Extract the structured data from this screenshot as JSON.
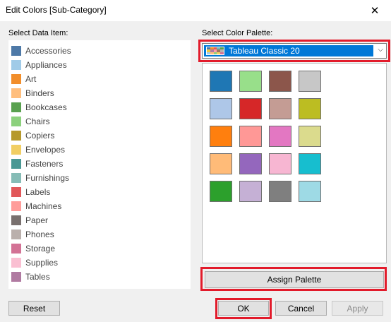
{
  "window": {
    "title": "Edit Colors [Sub-Category]",
    "close_glyph": "✕"
  },
  "left_panel": {
    "label": "Select Data Item:",
    "items": [
      {
        "label": "Accessories",
        "color": "#4e79a7"
      },
      {
        "label": "Appliances",
        "color": "#a0cbe8"
      },
      {
        "label": "Art",
        "color": "#f28e2b"
      },
      {
        "label": "Binders",
        "color": "#ffbe7d"
      },
      {
        "label": "Bookcases",
        "color": "#59a14f"
      },
      {
        "label": "Chairs",
        "color": "#8cd17d"
      },
      {
        "label": "Copiers",
        "color": "#b6992d"
      },
      {
        "label": "Envelopes",
        "color": "#f1ce63"
      },
      {
        "label": "Fasteners",
        "color": "#499894"
      },
      {
        "label": "Furnishings",
        "color": "#86bcb6"
      },
      {
        "label": "Labels",
        "color": "#e15759"
      },
      {
        "label": "Machines",
        "color": "#ff9d9a"
      },
      {
        "label": "Paper",
        "color": "#79706e"
      },
      {
        "label": "Phones",
        "color": "#bab0ac"
      },
      {
        "label": "Storage",
        "color": "#d37295"
      },
      {
        "label": "Supplies",
        "color": "#fabfd2"
      },
      {
        "label": "Tables",
        "color": "#b07aa1"
      }
    ]
  },
  "right_panel": {
    "label": "Select Color Palette:",
    "selected_palette": "Tableau Classic 20",
    "palette_icon_colors": [
      "#4e79a7",
      "#f28e2b",
      "#e15759",
      "#76b7b2",
      "#59a14f",
      "#edc948",
      "#b07aa1",
      "#ff9da7",
      "#9c755f",
      "#bab0ac",
      "#a0cbe8",
      "#ffbe7d",
      "#8cd17d",
      "#f1ce63",
      "#d37295"
    ],
    "palette_colors": [
      [
        "#1f77b4",
        "#98df8a",
        "#8c564b",
        "#c7c7c7"
      ],
      [
        "#aec7e8",
        "#d62728",
        "#c49c94",
        "#bcbd22"
      ],
      [
        "#ff7f0e",
        "#ff9896",
        "#e377c2",
        "#dbdb8d"
      ],
      [
        "#ffbb78",
        "#9467bd",
        "#f7b6d2",
        "#17becf"
      ],
      [
        "#2ca02c",
        "#c5b0d5",
        "#7f7f7f",
        "#9edae5"
      ]
    ]
  },
  "buttons": {
    "assign_palette": "Assign Palette",
    "reset": "Reset",
    "ok": "OK",
    "cancel": "Cancel",
    "apply": "Apply"
  },
  "highlight_color": "#e21b2b"
}
